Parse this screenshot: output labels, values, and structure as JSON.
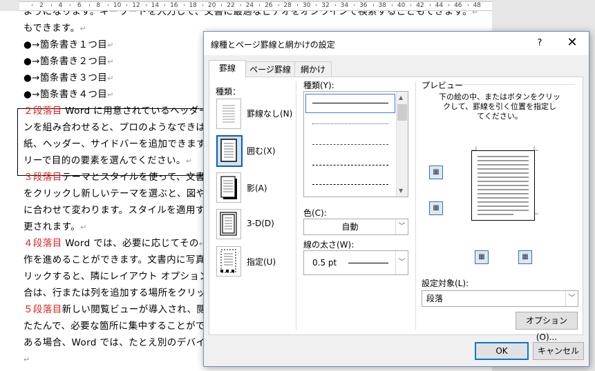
{
  "ruler": {
    "ticks": [
      "2",
      "4",
      "6",
      "8",
      "10",
      "12",
      "14",
      "16",
      "18",
      "20",
      "22",
      "24",
      "26",
      "28",
      "30",
      "32",
      "34",
      "36",
      "38",
      "40",
      "42",
      "44",
      "46",
      "48"
    ]
  },
  "document": {
    "lines": [
      {
        "text": "ようになります。キーワードを入力して、文書に最適なビデオをオンラインで検索することもできます。",
        "red": ""
      },
      {
        "text": "もできます。",
        "red": ""
      },
      {
        "text": "●→箇条書き１つ目",
        "red": ""
      },
      {
        "text": "●→箇条書き２つ目",
        "red": ""
      },
      {
        "text": "●→箇条書き３つ目",
        "red": ""
      },
      {
        "text": "●→箇条書き４つ目",
        "red": ""
      },
      {
        "text": " Word に用意されているヘッダー",
        "red": "２段落目"
      },
      {
        "text": "ンを組み合わせると、プロのようなできば",
        "red": ""
      },
      {
        "text": "紙、ヘッダー、サイドバーを追加できます",
        "red": ""
      },
      {
        "text": "リーで目的の要素を選んでください。",
        "red": ""
      },
      {
        "text": "テーマとスタイルを使って、文書",
        "red": "３段落目"
      },
      {
        "text": "をクリックし新しいテーマを選ぶと、図や",
        "red": ""
      },
      {
        "text": "に合わせて変わります。スタイルを適用す",
        "red": ""
      },
      {
        "text": "更されます。",
        "red": ""
      },
      {
        "text": " Word では、必要に応じてその",
        "red": "４段落目"
      },
      {
        "text": "作を進めることができます。文書内に写真",
        "red": ""
      },
      {
        "text": "リックすると、隣にレイアウト オプション",
        "red": ""
      },
      {
        "text": "合は、行または列を追加する場所をクリッ",
        "red": ""
      },
      {
        "text": "新しい閲覧ビューが導入され、閲",
        "red": "５段落目"
      },
      {
        "text": "たたんで、必要な箇所に集中することがで",
        "red": ""
      },
      {
        "text": "ある場合、Word では、たとえ別のデバイス",
        "red": ""
      },
      {
        "text": "",
        "red": ""
      }
    ],
    "para_mark": "↵"
  },
  "dialog": {
    "title": "線種とページ罫線と網かけの設定",
    "help": "?",
    "close": "✕",
    "tabs": [
      "罫線",
      "ページ罫線",
      "網かけ"
    ],
    "setting_label": "種類：",
    "settings": [
      {
        "label": "罫線なし(N)"
      },
      {
        "label": "囲む(X)"
      },
      {
        "label": "影(A)"
      },
      {
        "label": "3-D(D)"
      },
      {
        "label": "指定(U)"
      }
    ],
    "style_label": "種類(Y):",
    "color_label": "色(C):",
    "color_value": "自動",
    "width_label": "線の太さ(W):",
    "width_value": "0.5 pt",
    "preview_label": "プレビュー",
    "preview_hint": [
      "下の絵の中、またはボタンをクリッ",
      "クして、罫線を引く位置を指定し",
      "てください。"
    ],
    "apply_label": "設定対象(L):",
    "apply_value": "段落",
    "options_button": "オプション(O)...",
    "ok": "OK",
    "cancel": "キャンセル"
  }
}
